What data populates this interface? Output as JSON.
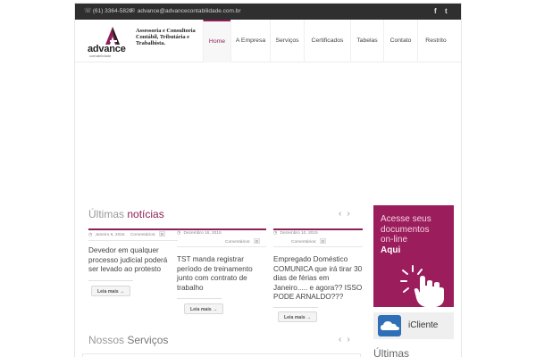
{
  "topbar": {
    "phone": "(61) 3364-5820",
    "email": "advance@advancecontabilidade.com.br",
    "social": [
      "f",
      "t"
    ]
  },
  "logo": {
    "word": "advance",
    "sub": "contabilidade",
    "tagline": "Assessoria e Consultoria Contábil, Tributária e Trabalhista."
  },
  "nav": {
    "items": [
      "Home",
      "A Empresa",
      "Serviços",
      "Certificados",
      "Tabelas",
      "Contato",
      "Restrito"
    ],
    "active": "Home"
  },
  "news": {
    "title_thin": "Últimas",
    "title_accent": "notícias",
    "comments_label": "Comentários:",
    "readmore": "Leia mais →",
    "cards": [
      {
        "date": "Janeiro 6, 2016",
        "comments": "0",
        "title": "Devedor em qualquer processo judicial poderá ser levado ao protesto"
      },
      {
        "date": "Dezembro 16, 2015",
        "comments": "0",
        "title": "TST manda registrar período de treinamento junto com contrato de trabalho"
      },
      {
        "date": "Dezembro 10, 2015",
        "comments": "0",
        "title": "Empregado Doméstico COMUNICA que irá tirar 30 dias de férias em Janeiro..... e agora?? ISSO PODE ARNALDO???"
      }
    ]
  },
  "services": {
    "title_thin": "Nossos",
    "title_accent": "Serviços"
  },
  "banner": {
    "line1": "Acesse seus",
    "line2": "documentos",
    "line3": "on-line",
    "line4": "Aqui"
  },
  "icliente": {
    "label": "iCliente"
  },
  "sidebar": {
    "ultimas": "Últimas"
  },
  "colors": {
    "accent": "#8e1f57",
    "banner": "#9b1d5b",
    "topbar": "#2f2f2f"
  }
}
